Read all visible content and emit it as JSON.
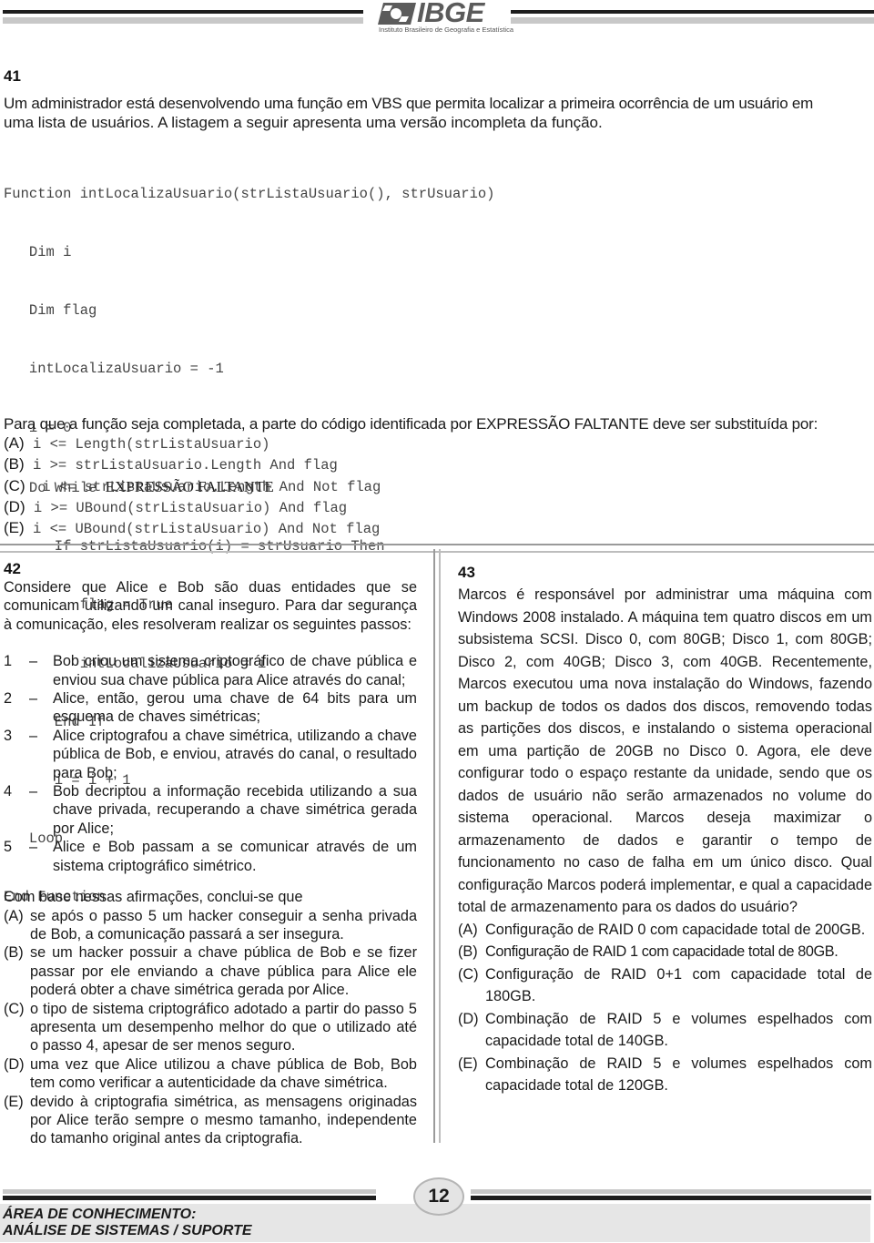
{
  "header": {
    "logo_text": "IBGE",
    "logo_subtitle": "Instituto Brasileiro de Geografia e Estatística",
    "logo_icon": "ibge-emblem-icon"
  },
  "q41": {
    "number": "41",
    "intro_line1": "Um administrador está desenvolvendo uma função em VBS que permita localizar a primeira ocorrência de um usuário em",
    "intro_line2": "uma lista de usuários. A listagem a seguir apresenta uma versão incompleta da função.",
    "code": [
      "Function intLocalizaUsuario(strListaUsuario(), strUsuario)",
      "   Dim i",
      "   Dim flag",
      "   intLocalizaUsuario = -1",
      "   i = 0",
      "   Do While ",
      "      If strListaUsuario(i) = strUsuario Then",
      "         flag = True",
      "         intLocalizaUsuario = i",
      "      End If",
      "      i = i + 1",
      "   Loop",
      "End Function"
    ],
    "missing_expression": "EXPRESSÃO FALTANTE",
    "question": "Para que a função seja completada, a parte do código identificada por EXPRESSÃO FALTANTE deve ser substituída por:",
    "options": [
      {
        "label": "(A)",
        "text": " i <= Length(strListaUsuario)"
      },
      {
        "label": "(B)",
        "text": " i >= strListaUsuario.Length And flag"
      },
      {
        "label": "(C)",
        "text": "  i <= strListaUsuario.Length And Not flag"
      },
      {
        "label": "(D)",
        "text": " i >= UBound(strListaUsuario) And flag"
      },
      {
        "label": "(E)",
        "text": " i <= UBound(strListaUsuario) And Not flag"
      }
    ]
  },
  "q42": {
    "number": "42",
    "intro": "Considere que Alice e Bob são duas entidades que se comunicam utilizando um canal inseguro. Para dar segurança à comunicação, eles resolveram realizar os seguintes passos:",
    "steps": [
      {
        "n": "1",
        "dash": "–",
        "text": "Bob criou um sistema criptográfico de chave pública e enviou sua chave pública para Alice através do canal;"
      },
      {
        "n": "2",
        "dash": "–",
        "text": "Alice, então, gerou uma chave de 64 bits para um esquema de chaves simétricas;"
      },
      {
        "n": "3",
        "dash": "–",
        "text": "Alice criptografou a chave simétrica, utilizando a chave pública de Bob, e enviou, através do canal, o resultado para Bob;"
      },
      {
        "n": "4",
        "dash": "–",
        "text": "Bob decriptou a informação recebida utilizando a sua chave privada, recuperando a chave simétrica gerada por Alice;"
      },
      {
        "n": "5",
        "dash": "–",
        "text": "Alice e Bob passam a se comunicar através de um sistema criptográfico simétrico."
      }
    ],
    "question": "Com base nessas afirmações, conclui-se que",
    "options": [
      {
        "label": "(A)",
        "text": "se após o passo 5 um hacker conseguir a senha privada de Bob, a comunicação passará a ser insegura."
      },
      {
        "label": "(B)",
        "text": "se um hacker possuir a chave pública de Bob e se fizer passar por ele enviando a chave pública para Alice ele poderá obter a chave simétrica gerada por Alice."
      },
      {
        "label": "(C)",
        "text": "o tipo de sistema criptográfico adotado a partir do passo 5 apresenta um desempenho melhor do que o utilizado até o passo 4, apesar de ser menos seguro."
      },
      {
        "label": "(D)",
        "text": "uma vez que Alice utilizou a chave pública de Bob, Bob tem como verificar a autenticidade da chave simétrica."
      },
      {
        "label": "(E)",
        "text": "devido à criptografia simétrica, as mensagens originadas por Alice terão sempre o mesmo tamanho, independente do tamanho original antes da criptografia."
      }
    ]
  },
  "q43": {
    "number": "43",
    "intro": "Marcos é responsável por administrar uma máquina com Windows 2008 instalado. A máquina tem quatro discos em um subsistema SCSI. Disco 0, com 80GB; Disco 1, com 80GB; Disco 2, com 40GB; Disco 3, com 40GB. Recentemente, Marcos executou uma nova instalação do Windows, fazendo um backup de todos os dados dos discos, removendo todas as partições dos discos, e instalando o sistema operacional em uma partição de 20GB no Disco 0. Agora, ele deve configurar todo o espaço restante da unidade, sendo que os dados de usuário não serão armazenados no volume do sistema operacional. Marcos deseja maximizar o armazenamento de dados e garantir o tempo de funcionamento no caso de falha em um único disco. Qual configuração Marcos poderá implementar, e qual a capacidade total de armazenamento para os dados do usuário?",
    "options": [
      {
        "label": "(A)",
        "text": "Configuração de RAID 0 com capacidade total de 200GB."
      },
      {
        "label": "(B)",
        "text": "Configuração de RAID 1 com capacidade total de 80GB."
      },
      {
        "label": "(C)",
        "text": "Configuração de RAID 0+1 com capacidade total de 180GB."
      },
      {
        "label": "(D)",
        "text": "Combinação de RAID 5 e volumes espelhados com capacidade total de 140GB."
      },
      {
        "label": "(E)",
        "text": "Combinação de RAID 5 e volumes espelhados com capacidade total de 120GB."
      }
    ]
  },
  "footer": {
    "page_number": "12",
    "area_line1": "ÁREA DE CONHECIMENTO:",
    "area_line2": "ANÁLISE DE SISTEMAS / SUPORTE"
  }
}
